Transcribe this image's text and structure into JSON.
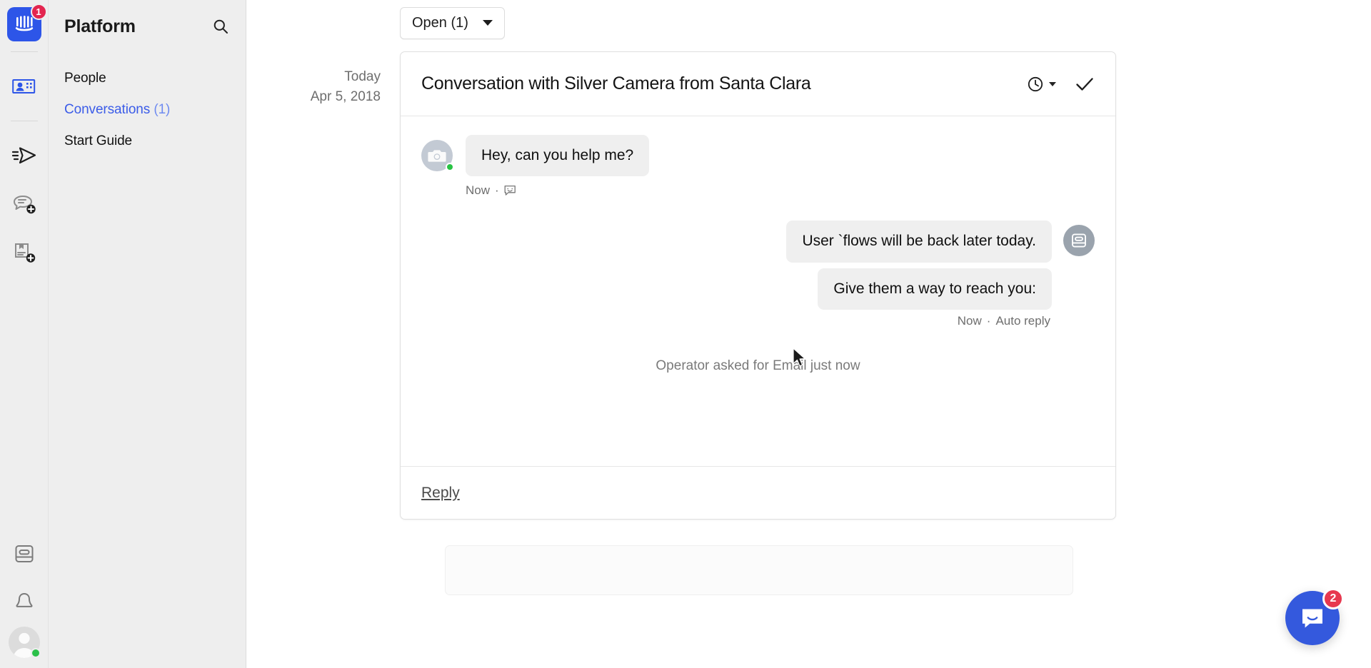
{
  "rail": {
    "logo": {
      "name": "intercom-logo",
      "badge": "1"
    },
    "icons": [
      {
        "name": "contacts-icon",
        "label": "Contacts",
        "active": true
      },
      {
        "name": "outbound-send-icon",
        "label": "Outbound",
        "active": false
      },
      {
        "name": "new-conversation-icon",
        "label": "New conversation",
        "active": false
      },
      {
        "name": "new-article-icon",
        "label": "New article",
        "active": false
      },
      {
        "name": "operator-bot-icon",
        "label": "Operator",
        "active": false
      },
      {
        "name": "bell-icon",
        "label": "Notifications",
        "active": false
      }
    ],
    "avatar": {
      "name": "user-avatar",
      "status": "online"
    }
  },
  "nav": {
    "title": "Platform",
    "search_icon": "search-icon",
    "items": [
      {
        "label": "People",
        "count": "",
        "active": false
      },
      {
        "label": "Conversations",
        "count": "(1)",
        "active": true
      },
      {
        "label": "Start Guide",
        "count": "",
        "active": false
      }
    ]
  },
  "toolbar": {
    "status_label": "Open (1)",
    "caret_icon": "chevron-down-icon"
  },
  "conversation": {
    "date_today": "Today",
    "date_full": "Apr 5, 2018",
    "title": "Conversation with Silver Camera from Santa Clara",
    "snooze_icon": "clock-icon",
    "snooze_caret_icon": "chevron-down-icon",
    "close_icon": "check-icon",
    "messages": [
      {
        "direction": "in",
        "avatar_icon": "camera-avatar-icon",
        "status": "online",
        "text": "Hey, can you help me?",
        "meta_time": "Now",
        "meta_sep": "·",
        "meta_icon": "chat-bubble-icon"
      },
      {
        "direction": "out",
        "avatar_icon": "operator-bot-icon",
        "bubbles": [
          "User `flows will be back later today.",
          "Give them a way to reach you:"
        ],
        "meta_time": "Now",
        "meta_sep": "·",
        "meta_label": "Auto reply"
      }
    ],
    "system_note": "Operator asked for Email just now",
    "reply_label": "Reply"
  },
  "launcher": {
    "name": "intercom-messenger-launcher",
    "badge": "2",
    "color": "#3459dd"
  },
  "colors": {
    "accent_blue": "#3459dd",
    "link_blue": "#3b5ce8",
    "badge_red": "#e3254f",
    "online_green": "#2bc04a",
    "bubble_gray": "#efefef",
    "panel_gray": "#eeeeee"
  }
}
